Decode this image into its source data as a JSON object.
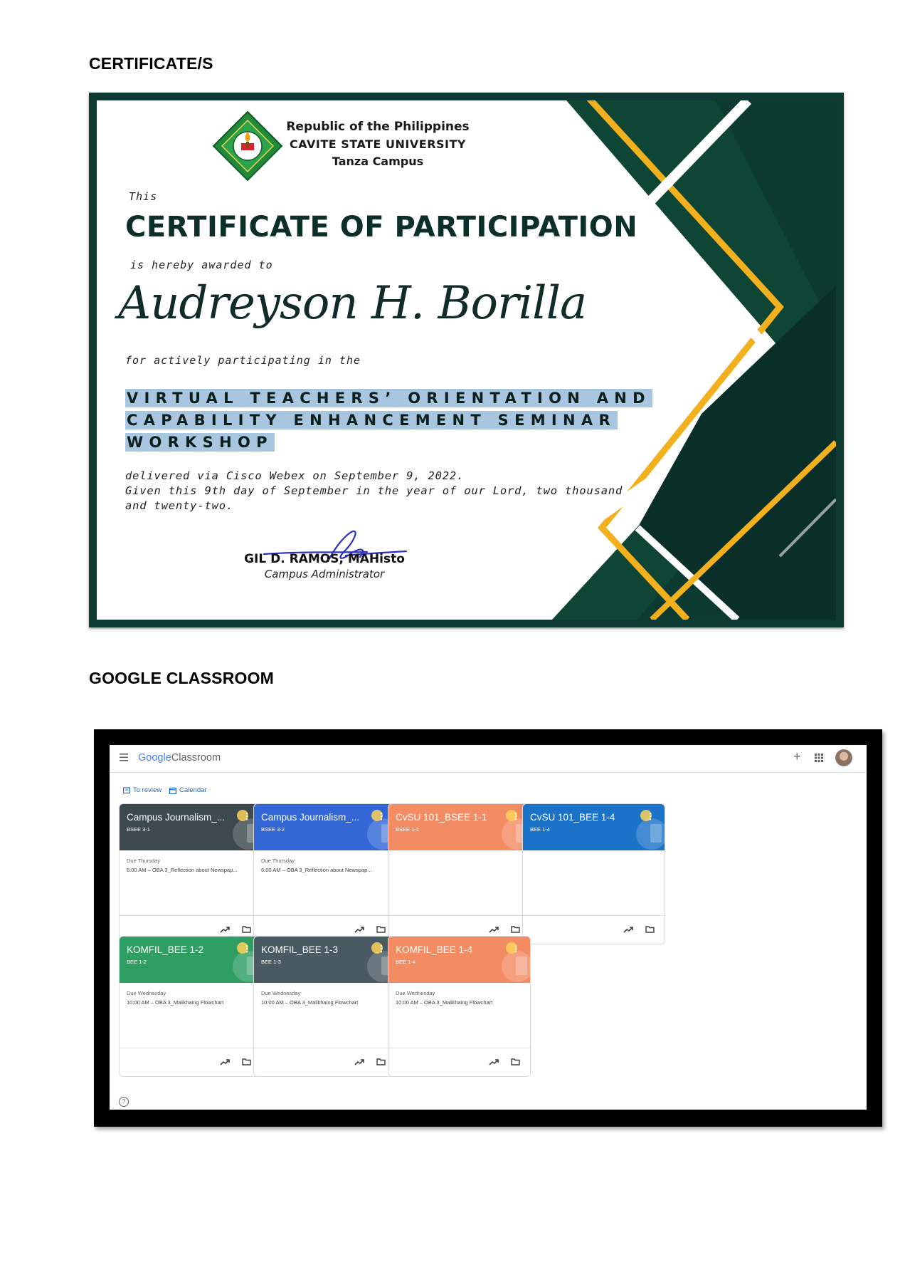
{
  "sections": {
    "certificates_title": "CERTIFICATE/S",
    "classroom_title": "GOOGLE CLASSROOM"
  },
  "certificate": {
    "header_line1": "Republic of the Philippines",
    "header_line2": "CAVITE STATE UNIVERSITY",
    "header_line3": "Tanza Campus",
    "this_label": "This",
    "title": "CERTIFICATE OF PARTICIPATION",
    "awarded_to": "is hereby awarded to",
    "recipient": "Audreyson H. Borilla",
    "participating": "for actively participating in the",
    "event_line1": "VIRTUAL TEACHERS’ ORIENTATION AND",
    "event_line2": "CAPABILITY ENHANCEMENT SEMINAR",
    "event_line3": "WORKSHOP",
    "body_line1": "delivered via Cisco Webex on September 9, 2022.",
    "body_line2": "Given this 9th day of September in the year of our Lord, two thousand",
    "body_line3": "and twenty-two.",
    "signer_name": "GIL D. RAMOS, MAHisto",
    "signer_title": "Campus Administrator",
    "colors": {
      "dark_green": "#0d3a32",
      "gold": "#f2b01e",
      "highlight": "#a8c6e0"
    }
  },
  "classroom": {
    "app_name_google": "Google",
    "app_name": "Classroom",
    "to_review": "To review",
    "calendar": "Calendar",
    "courses": [
      {
        "title": "Campus Journalism_...",
        "section": "BSEE 3-1",
        "due": "Due Thursday",
        "task": "6:00 AM – OBA 3_Reflection about Newspap...",
        "color": "#3c4a4f"
      },
      {
        "title": "Campus Journalism_...",
        "section": "BSEE 3-2",
        "due": "Due Thursday",
        "task": "6:00 AM – OBA 3_Reflection about Newspap...",
        "color": "#3367d6"
      },
      {
        "title": "CvSU 101_BSEE 1-1",
        "section": "BSEE 1-1",
        "due": "",
        "task": "",
        "color": "#f38b63"
      },
      {
        "title": "CvSU 101_BEE 1-4",
        "section": "BEE 1-4",
        "due": "",
        "task": "",
        "color": "#1a73c8"
      },
      {
        "title": "KOMFIL_BEE 1-2",
        "section": "BEE 1-2",
        "due": "Due Wednesday",
        "task": "10:00 AM – OBA 3_Malikhaing Flowchart",
        "color": "#2f9e62"
      },
      {
        "title": "KOMFIL_BEE 1-3",
        "section": "BEE 1-3",
        "due": "Due Wednesday",
        "task": "10:00 AM – OBA 3_Malikhaing Flowchart",
        "color": "#4a5a62"
      },
      {
        "title": "KOMFIL_BEE 1-4",
        "section": "BEE 1-4",
        "due": "Due Wednesday",
        "task": "10:00 AM – OBA 3_Malikhaing Flowchart",
        "color": "#f38b63"
      }
    ],
    "icons": [
      "menu-icon",
      "plus-icon",
      "apps-grid-icon",
      "avatar",
      "trending-icon",
      "folder-icon",
      "help-icon"
    ]
  }
}
